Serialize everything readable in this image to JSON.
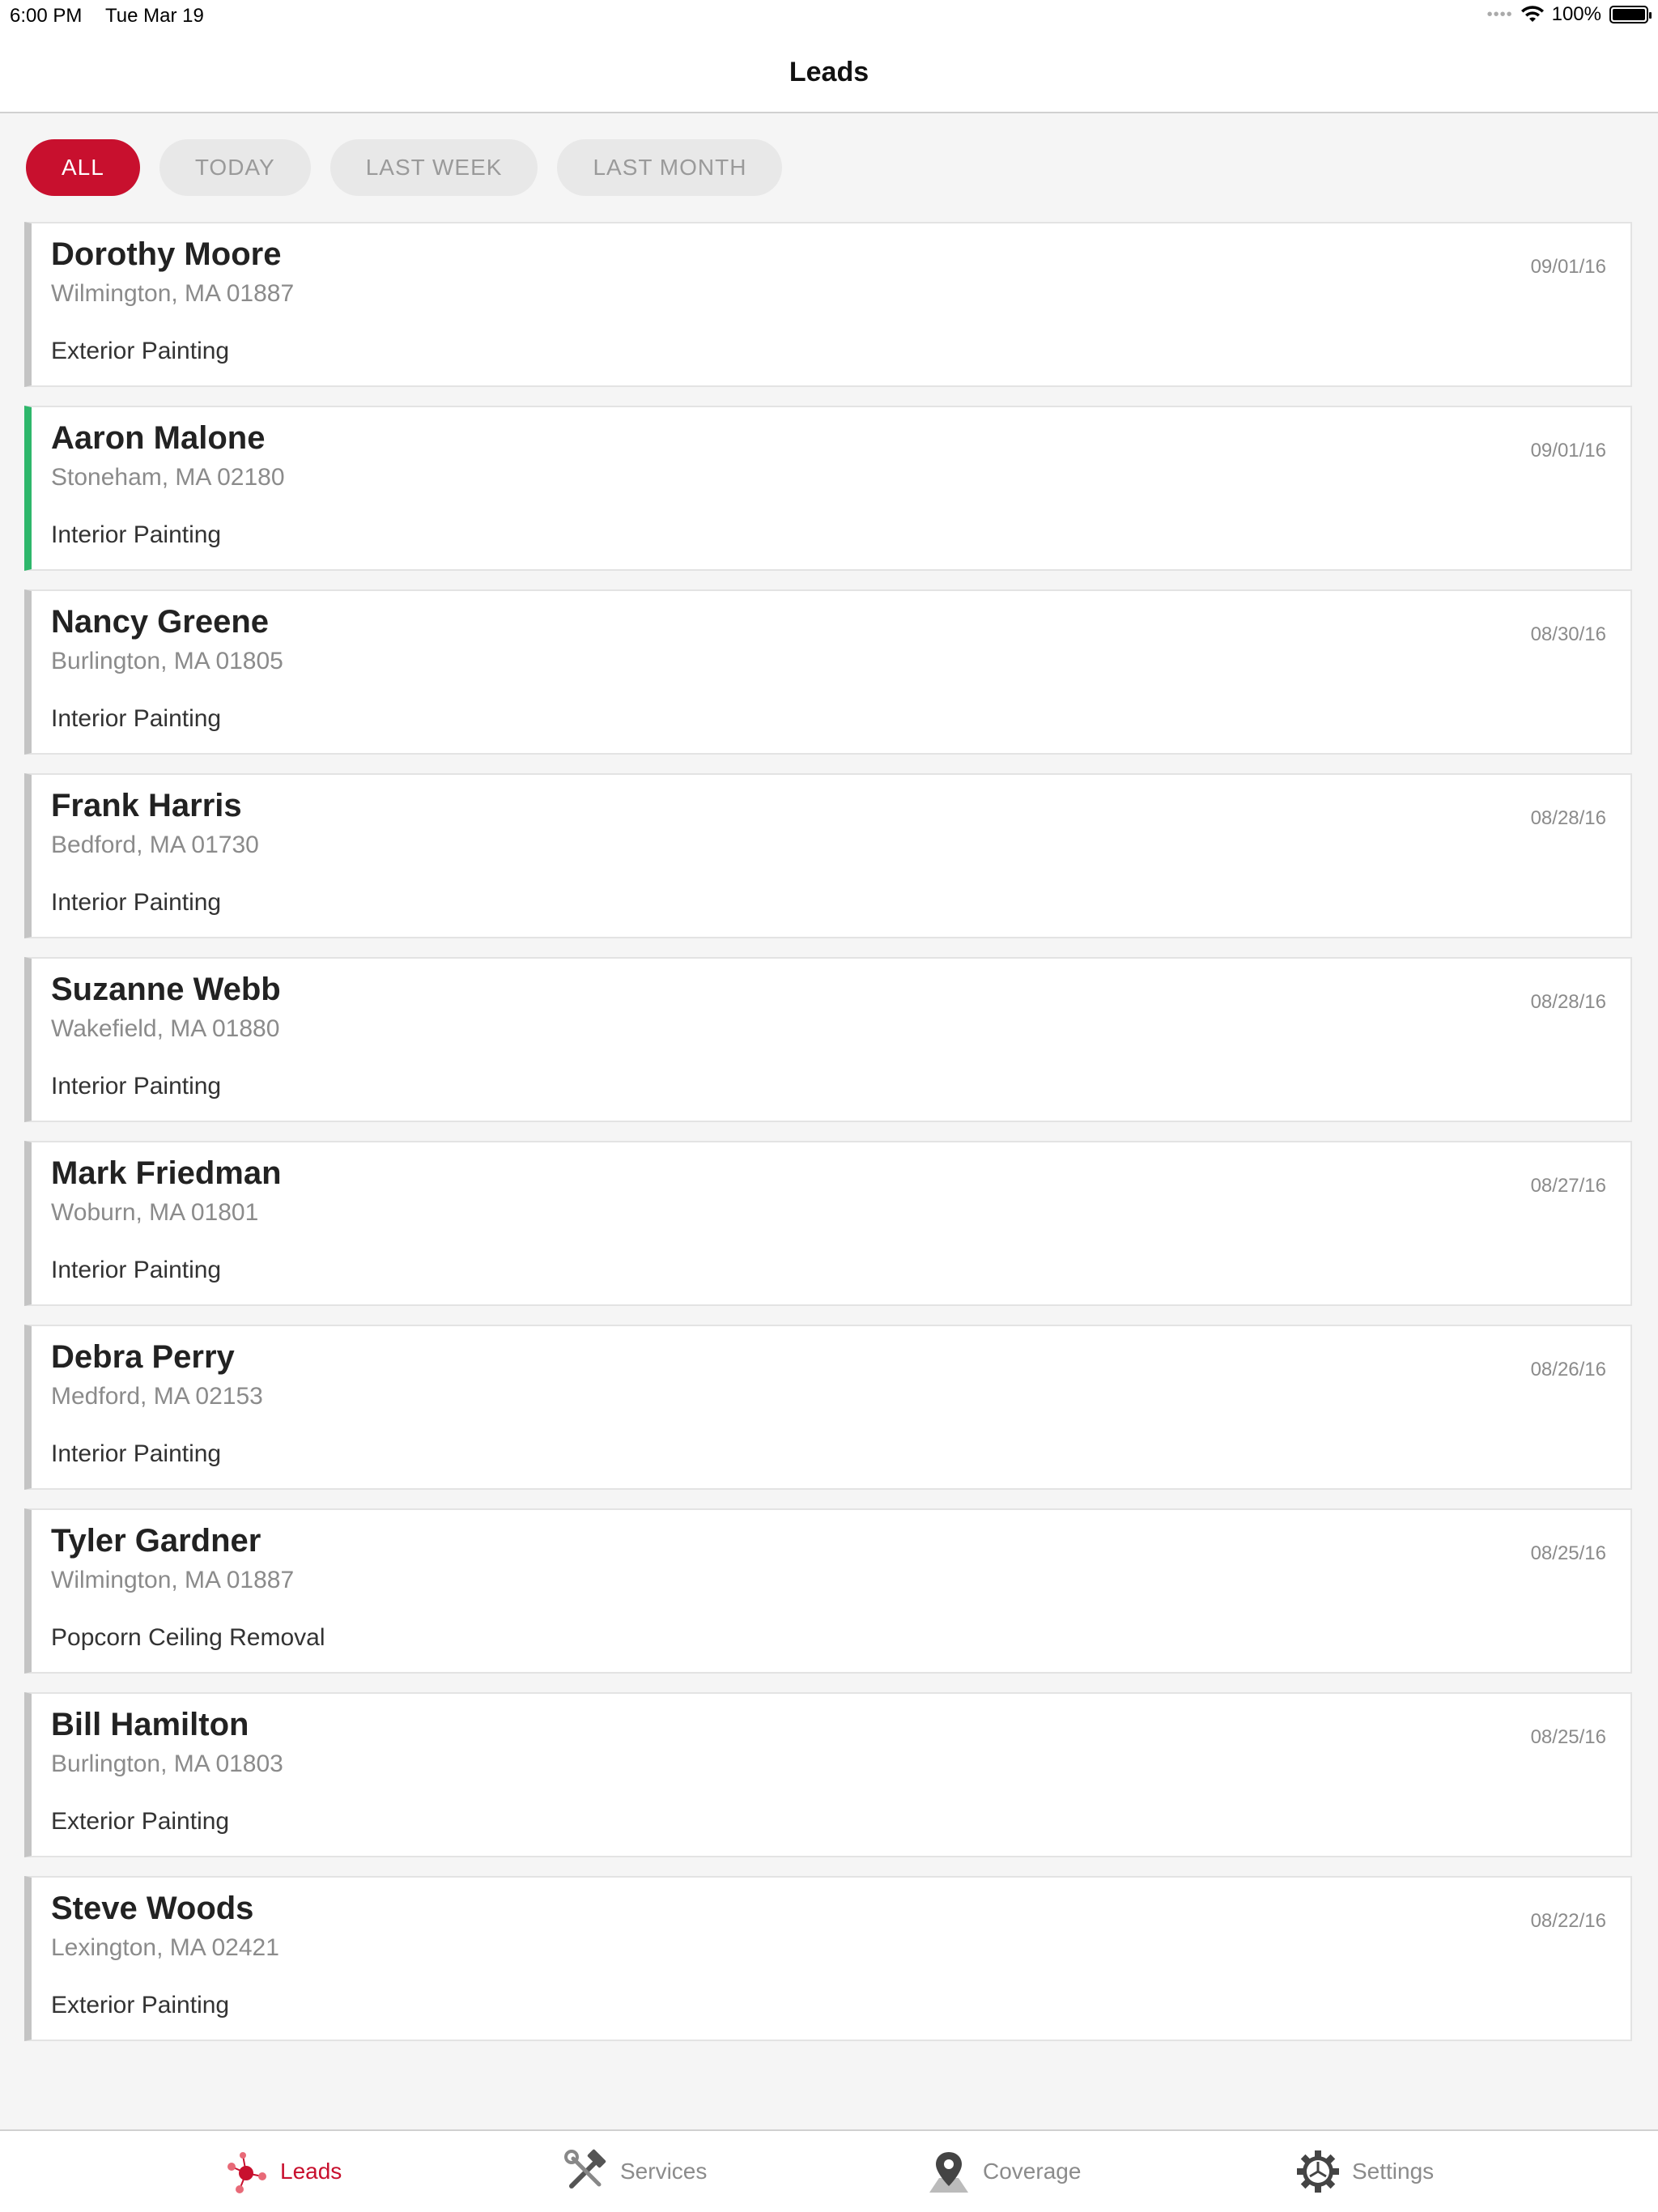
{
  "status_bar": {
    "time": "6:00 PM",
    "date": "Tue Mar 19",
    "battery": "100%",
    "icons": [
      "signal-dots-icon",
      "wifi-icon",
      "battery-icon"
    ]
  },
  "header": {
    "title": "Leads"
  },
  "filters": [
    {
      "label": "ALL",
      "active": true
    },
    {
      "label": "TODAY",
      "active": false
    },
    {
      "label": "LAST WEEK",
      "active": false
    },
    {
      "label": "LAST MONTH",
      "active": false
    }
  ],
  "leads": [
    {
      "name": "Dorothy Moore",
      "location": "Wilmington, MA 01887",
      "service": "Exterior Painting",
      "date": "09/01/16",
      "status": "default"
    },
    {
      "name": "Aaron Malone",
      "location": "Stoneham, MA 02180",
      "service": "Interior Painting",
      "date": "09/01/16",
      "status": "new"
    },
    {
      "name": "Nancy Greene",
      "location": "Burlington, MA 01805",
      "service": "Interior Painting",
      "date": "08/30/16",
      "status": "default"
    },
    {
      "name": "Frank Harris",
      "location": "Bedford, MA 01730",
      "service": "Interior Painting",
      "date": "08/28/16",
      "status": "default"
    },
    {
      "name": "Suzanne Webb",
      "location": "Wakefield, MA 01880",
      "service": "Interior Painting",
      "date": "08/28/16",
      "status": "default"
    },
    {
      "name": "Mark Friedman",
      "location": "Woburn, MA 01801",
      "service": "Interior Painting",
      "date": "08/27/16",
      "status": "default"
    },
    {
      "name": "Debra Perry",
      "location": "Medford, MA 02153",
      "service": "Interior Painting",
      "date": "08/26/16",
      "status": "default"
    },
    {
      "name": "Tyler Gardner",
      "location": "Wilmington, MA 01887",
      "service": "Popcorn Ceiling Removal",
      "date": "08/25/16",
      "status": "default"
    },
    {
      "name": "Bill Hamilton",
      "location": "Burlington, MA 01803",
      "service": "Exterior Painting",
      "date": "08/25/16",
      "status": "default"
    },
    {
      "name": "Steve Woods",
      "location": "Lexington, MA 02421",
      "service": "Exterior Painting",
      "date": "08/22/16",
      "status": "default"
    }
  ],
  "tabbar": {
    "items": [
      {
        "label": "Leads",
        "icon": "leads-network-icon",
        "active": true
      },
      {
        "label": "Services",
        "icon": "hammer-wrench-icon",
        "active": false
      },
      {
        "label": "Coverage",
        "icon": "map-pin-icon",
        "active": false
      },
      {
        "label": "Settings",
        "icon": "gear-icon",
        "active": false
      }
    ]
  },
  "colors": {
    "accent": "#c8102e",
    "new_lead": "#2eb76b",
    "default_lead": "#c4c4c4",
    "muted_text": "#8b8b8b"
  }
}
